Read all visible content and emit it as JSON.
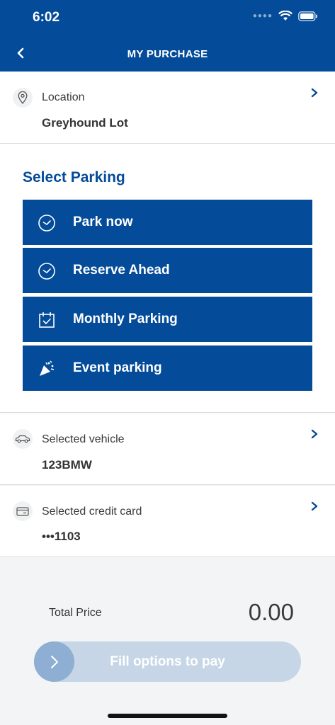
{
  "status_bar": {
    "time": "6:02"
  },
  "header": {
    "title": "MY PURCHASE"
  },
  "location": {
    "label": "Location",
    "value": "Greyhound Lot"
  },
  "select_parking": {
    "title": "Select Parking",
    "options": [
      {
        "label": "Park now",
        "icon": "clock-icon"
      },
      {
        "label": "Reserve Ahead",
        "icon": "clock-icon"
      },
      {
        "label": "Monthly Parking",
        "icon": "calendar-check-icon"
      },
      {
        "label": "Event parking",
        "icon": "party-popper-icon"
      }
    ]
  },
  "vehicle": {
    "label": "Selected vehicle",
    "value": "123BMW"
  },
  "credit_card": {
    "label": "Selected credit card",
    "value": "•••1103"
  },
  "total": {
    "label": "Total Price",
    "value": "0.00"
  },
  "pay_button": {
    "label": "Fill options to pay"
  },
  "colors": {
    "brand": "#044b99",
    "pay_disabled": "#c6d6e6"
  }
}
